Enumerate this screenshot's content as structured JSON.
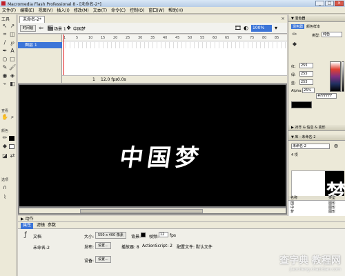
{
  "window": {
    "title": "Macromedia Flash Professional 8 - [未命名-2*]"
  },
  "window_controls": {
    "minimize": "_",
    "maximize": "□",
    "close": "×"
  },
  "menu": [
    "文件(F)",
    "编辑(E)",
    "视图(V)",
    "插入(I)",
    "修改(M)",
    "文本(T)",
    "命令(C)",
    "控制(O)",
    "窗口(W)",
    "帮助(H)"
  ],
  "tools": {
    "header": "工具",
    "view_label": "查看",
    "colors_label": "颜色",
    "options_label": "选项"
  },
  "document": {
    "tab": "未命名-2*",
    "timeline_button": "时间轴",
    "breadcrumb": [
      "场景 1",
      "中国梦"
    ],
    "zoom": "100%",
    "layer_name": "图层 1",
    "ruler": [
      "1",
      "5",
      "10",
      "15",
      "20",
      "25",
      "30",
      "35",
      "40",
      "45",
      "50",
      "55",
      "60",
      "65",
      "70",
      "75",
      "80",
      "85"
    ],
    "frame": "1",
    "fps": "12.0 fps",
    "time": "0.0s"
  },
  "stage": {
    "text": "中国梦",
    "background": "#000000"
  },
  "panels": {
    "actions_title": "▶ 动作",
    "properties_tabs": [
      "属性",
      "滤镜",
      "参数"
    ],
    "properties": {
      "type": "文档",
      "name": "未命名-2",
      "size_label": "大小:",
      "size_value": "550 x 400 像素",
      "bg_label": "背景:",
      "fps_label": "帧频:",
      "fps_value": "12",
      "fps_unit": "fps",
      "publish_label": "发布:",
      "settings_button": "设置...",
      "player_label": "播放器: 8",
      "as_label": "ActionScript: 2",
      "profile_label": "配置文件: 默认文件",
      "device_label": "设备:",
      "device_button": "设置..."
    }
  },
  "right_panel": {
    "mixer_header": "▼ 混色器",
    "mixer_tabs": [
      "混色器",
      "颜色样本"
    ],
    "type_label": "类型:",
    "type_value": "纯色",
    "red_label": "红:",
    "red_value": "255",
    "green_label": "绿:",
    "green_value": "255",
    "blue_label": "蓝:",
    "blue_value": "255",
    "alpha_label": "Alpha:",
    "alpha_value": "25%",
    "hex_value": "#FFFFFF",
    "align_header": "▶ 对齐 & 信息 & 变形",
    "library_header": "▼ 库 - 未命名-2",
    "library_doc": "未命名-2",
    "library_count": "4 项",
    "library_columns": [
      "名称",
      "类型"
    ],
    "library_items": [
      {
        "name": "国",
        "type": "图形"
      },
      {
        "name": "中",
        "type": "图形"
      },
      {
        "name": "梦",
        "type": "图形"
      },
      {
        "name": "中国梦",
        "type": "图形"
      }
    ]
  },
  "colors": {
    "accent": "#3c75d8",
    "stage_bg": "#000000",
    "playhead": "#e31b1b",
    "chrome": "#ece9d8"
  },
  "watermark": {
    "line1": "查字典 教程网",
    "line2": "jiaocheng.chazidian.com"
  }
}
